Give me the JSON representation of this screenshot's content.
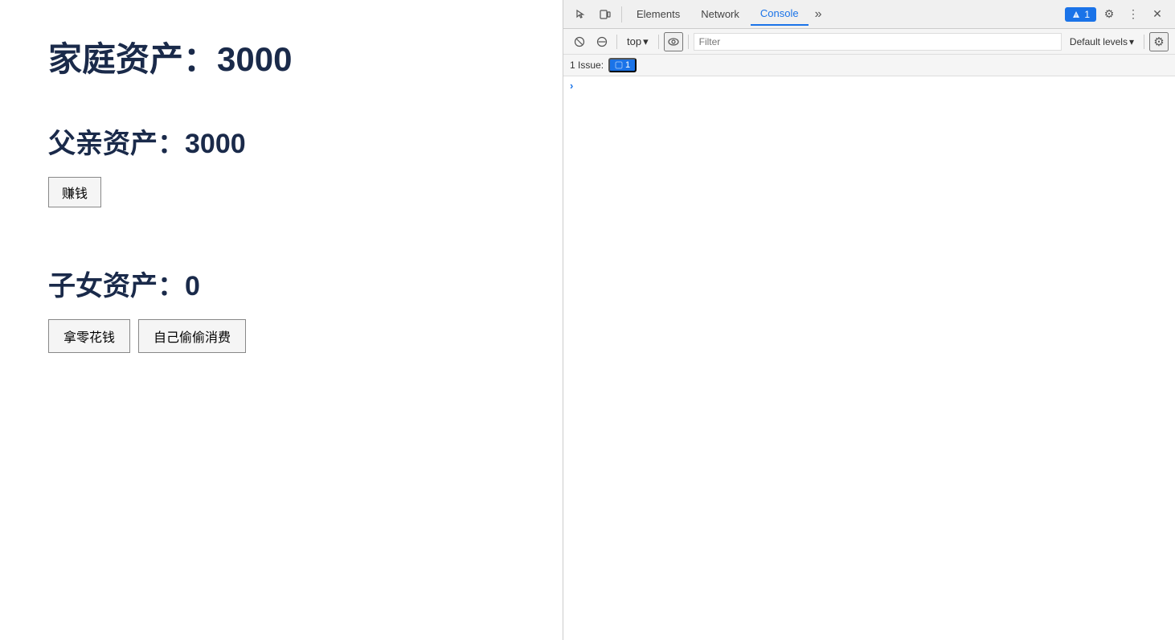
{
  "main": {
    "family_assets_label": "家庭资产：",
    "family_assets_value": "3000",
    "father_assets_label": "父亲资产：",
    "father_assets_value": "3000",
    "earn_button_label": "赚钱",
    "child_assets_label": "子女资产：",
    "child_assets_value": "0",
    "get_allowance_label": "拿零花钱",
    "spend_secret_label": "自己偷偷消费"
  },
  "devtools": {
    "tab_elements": "Elements",
    "tab_network": "Network",
    "tab_console": "Console",
    "badge_label": "1",
    "context_label": "top",
    "filter_placeholder": "Filter",
    "levels_label": "Default levels",
    "issues_label": "1 Issue:",
    "issues_count": "1",
    "console_arrow": "›"
  }
}
